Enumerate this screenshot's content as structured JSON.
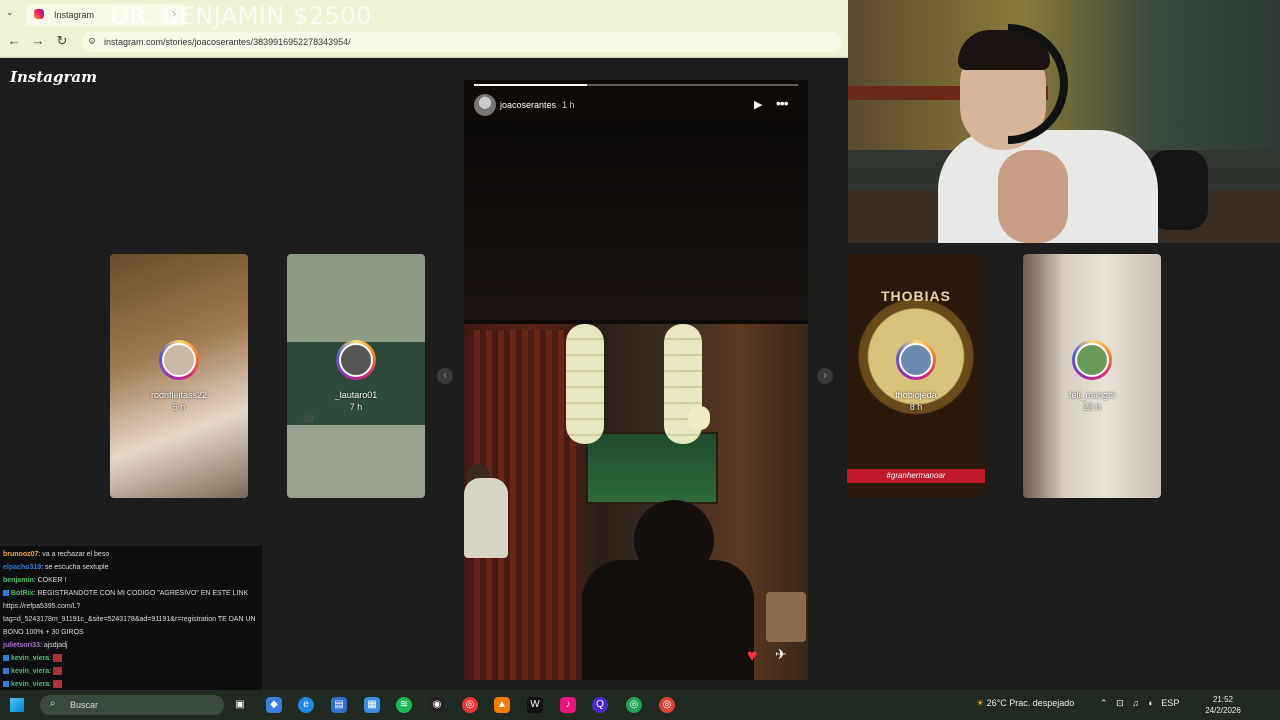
{
  "overlay": {
    "text": "OR: BENJAMIN $2500"
  },
  "browser": {
    "tab_title": "Instagram",
    "url": "instagram.com/stories/joacoserantes/3839916952278343954/",
    "back_icon": "arrow-left-icon",
    "forward_icon": "arrow-right-icon",
    "reload_icon": "reload-icon"
  },
  "instagram": {
    "logo": "Instagram",
    "left_stories": [
      {
        "username": "rodrifleitass22",
        "time": "5 h",
        "caption": ""
      },
      {
        "username": "_lautaro01",
        "time": "7 h",
        "caption": "24"
      }
    ],
    "main_story": {
      "username": "joacoserantes",
      "time": "1 h",
      "progress": 0.35
    },
    "right_stories": [
      {
        "username": "thobiojeda",
        "time": "8 h",
        "banner": "THOBIAS",
        "hashtag": "#granhermanoar"
      },
      {
        "username": "feli_manghi",
        "time": "23 h"
      }
    ]
  },
  "chat": {
    "messages": [
      {
        "user": "brunooz07",
        "color": "#f4a340",
        "text": ": va a rechazar el beso",
        "badge": false
      },
      {
        "user": "elpacho319",
        "color": "#2d7bd4",
        "text": ": se escucha sextuple",
        "badge": false
      },
      {
        "user": "benjamin",
        "color": "#4ac06a",
        "text": ": COKER !",
        "badge": false
      },
      {
        "user": "BotRix",
        "color": "#4ac06a",
        "text": ": REGISTRANDOTE CON MI CODIGO \"AGRESIVO\" EN ESTE LINK",
        "badge": true
      },
      {
        "user": "",
        "color": "#ddd",
        "text": "https://refpa5395.com/L?",
        "badge": false
      },
      {
        "user": "",
        "color": "#ddd",
        "text": "tag=d_5243178m_91191c_&site=5243178&ad=91191&r=registration TE DAN UN",
        "badge": false
      },
      {
        "user": "",
        "color": "#ddd",
        "text": "BONO 100% + 30 GIROS",
        "badge": false
      },
      {
        "user": "julietsori33",
        "color": "#b36bd4",
        "text": ": ajsdjadj",
        "badge": false
      },
      {
        "user": "kevin_viera",
        "color": "#4ac06a",
        "text": ":",
        "badge": true
      },
      {
        "user": "kevin_viera",
        "color": "#4ac06a",
        "text": ":",
        "badge": true
      },
      {
        "user": "kevin_viera",
        "color": "#4ac06a",
        "text": ":",
        "badge": true
      },
      {
        "user": "kevin_viera",
        "color": "#4ac06a",
        "text": ":",
        "badge": true
      }
    ]
  },
  "taskbar": {
    "search_placeholder": "Buscar",
    "weather": "26°C  Prac. despejado",
    "language": "ESP",
    "time": "21:52",
    "date": "24/2/2026"
  }
}
